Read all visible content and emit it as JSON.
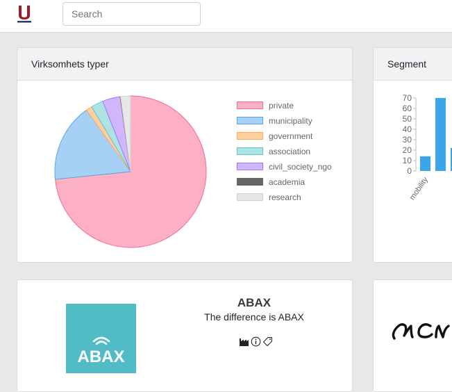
{
  "header": {
    "logo_icon": "university-u-logo-icon",
    "search_placeholder": "Search"
  },
  "types_card": {
    "title": "Virksomhets typer",
    "chart_data": {
      "type": "pie",
      "title": "",
      "legend_position": "right",
      "categories": [
        "private",
        "municipality",
        "government",
        "association",
        "civil_society_ngo",
        "academia",
        "research"
      ],
      "values": [
        73.4,
        16.7,
        1.3,
        2.6,
        3.8,
        0.1,
        2.1
      ],
      "colors": [
        "#fdb0c4",
        "#a7d1f4",
        "#ffcfa0",
        "#aee3e3",
        "#d2b6fd",
        "#666666",
        "#e7e7e7"
      ],
      "borders": [
        "#f4698f",
        "#57a7e8",
        "#ffab5c",
        "#5ec8c8",
        "#a874fb",
        "#666666",
        "#d0d0d0"
      ]
    }
  },
  "segment_card": {
    "title": "Segment",
    "chart_data": {
      "type": "bar",
      "title": "",
      "categories": [
        "mobility",
        "",
        ""
      ],
      "values": [
        14,
        70,
        22
      ],
      "ylim": [
        0,
        70
      ],
      "yticks": [
        0,
        10,
        20,
        30,
        40,
        50,
        60,
        70
      ],
      "bar_color": "#3ba5ea",
      "grid": false
    }
  },
  "org_card": {
    "logo_text": "ABAX",
    "name": "ABAX",
    "tagline": "The difference is ABAX",
    "icons": [
      "factory-icon",
      "info-icon",
      "tag-icon"
    ],
    "logo_color": "#52bcc6"
  },
  "acn_card": {
    "logo_text": "ACN"
  }
}
